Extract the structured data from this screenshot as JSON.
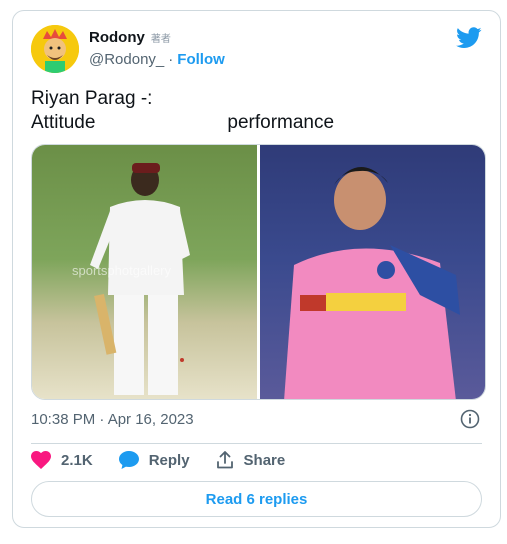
{
  "tweet": {
    "author": {
      "display_name": "Rodony",
      "name_badge": "著者",
      "handle": "@Rodony_",
      "separator": "·",
      "follow_label": "Follow"
    },
    "text_line1": "Riyan Parag -:",
    "text_line2": "Attitude                         performance",
    "media": {
      "left_watermark": "sportsphotgallery"
    },
    "timestamp": "10:38 PM · Apr 16, 2023",
    "actions": {
      "likes": "2.1K",
      "reply_label": "Reply",
      "share_label": "Share"
    },
    "read_replies_label": "Read 6 replies"
  },
  "colors": {
    "accent": "#1d9bf0",
    "like": "#f91880",
    "muted": "#536471",
    "border": "#cfd9de"
  },
  "icons": [
    "avatar",
    "twitter-bird-icon",
    "info-icon",
    "heart-icon",
    "reply-bubble-icon",
    "share-icon"
  ]
}
